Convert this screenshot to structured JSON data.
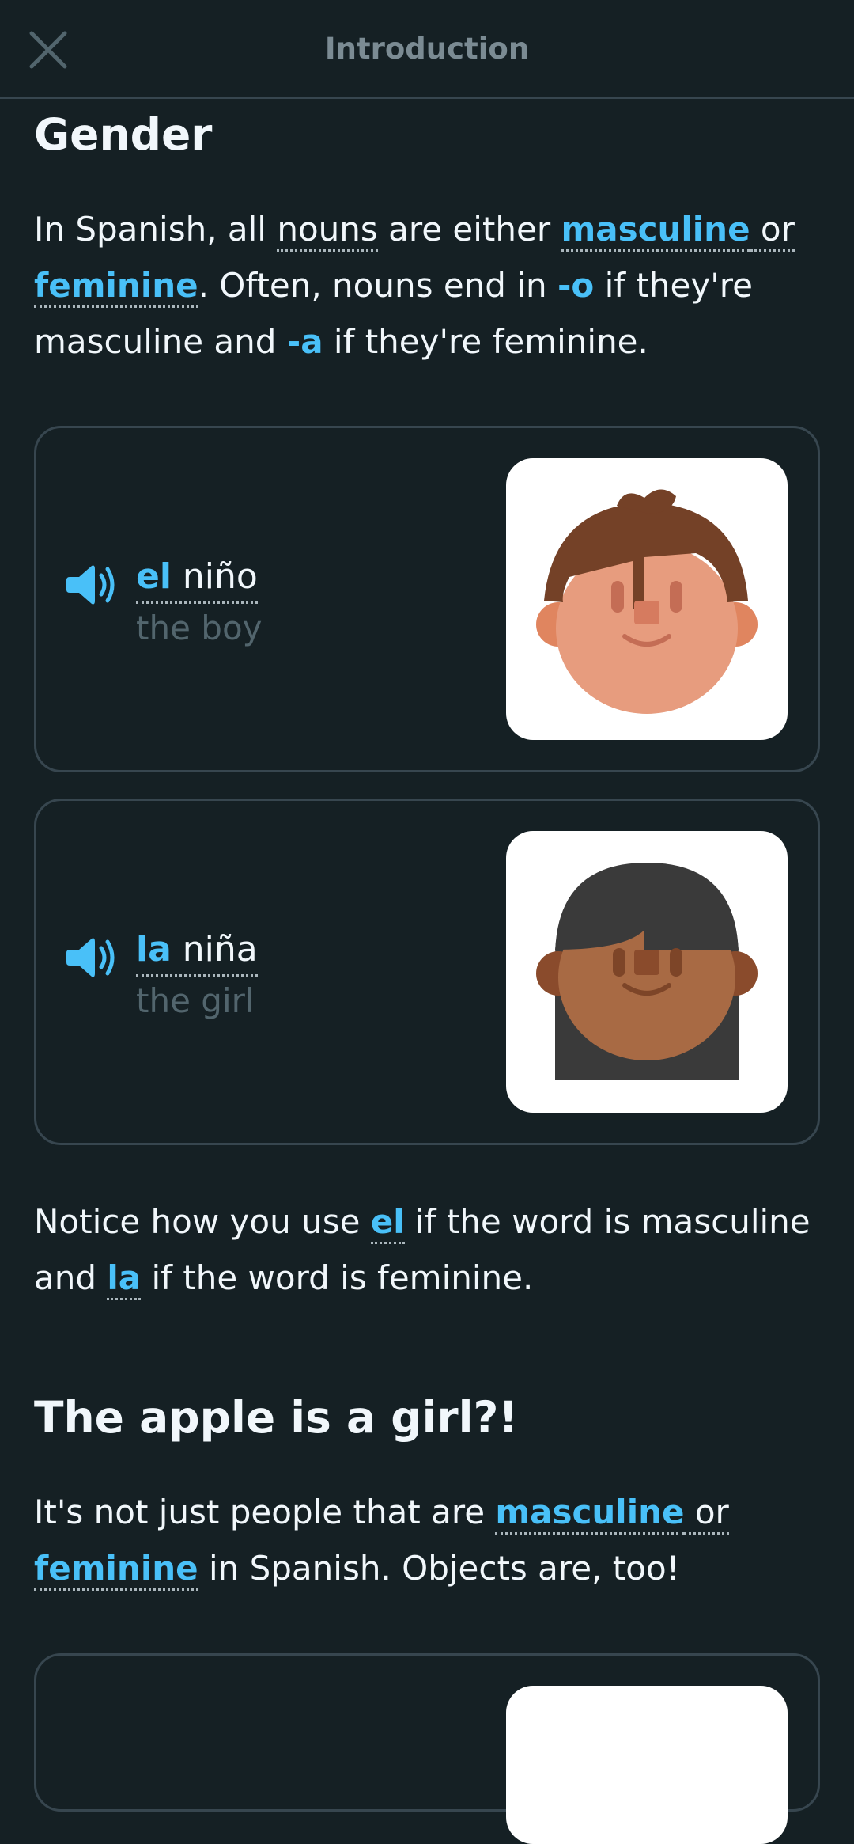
{
  "header": {
    "title": "Introduction",
    "close_icon": "close-icon"
  },
  "section1": {
    "heading": "Gender",
    "p1": {
      "t1": "In Spanish, all ",
      "nouns": "nouns",
      "t2": " are either ",
      "masculine": "masculine",
      "or": " or ",
      "feminine": "feminine",
      "t3": ". Often, nouns end in ",
      "o": "-o",
      "t4": " if they're masculine and ",
      "a": "-a",
      "t5": " if they're feminine."
    }
  },
  "cards": [
    {
      "article": "el",
      "noun": " niño",
      "translation": "the boy",
      "icon": "boy-face"
    },
    {
      "article": "la",
      "noun": " niña",
      "translation": "the girl",
      "icon": "girl-face"
    }
  ],
  "notice": {
    "t1": "Notice how you use ",
    "el": "el",
    "t2": " if the word is masculine and ",
    "la": "la",
    "t3": " if the word is feminine."
  },
  "section2": {
    "heading": "The apple is a girl?!",
    "p": {
      "t1": "It's not just people that are ",
      "masculine": "masculine",
      "or": " or ",
      "feminine": "feminine",
      "t2": " in Spanish. Objects are, too!"
    }
  },
  "colors": {
    "background": "#152024",
    "accent": "#49c0f8",
    "border": "#37464f",
    "muted": "#52656d"
  }
}
